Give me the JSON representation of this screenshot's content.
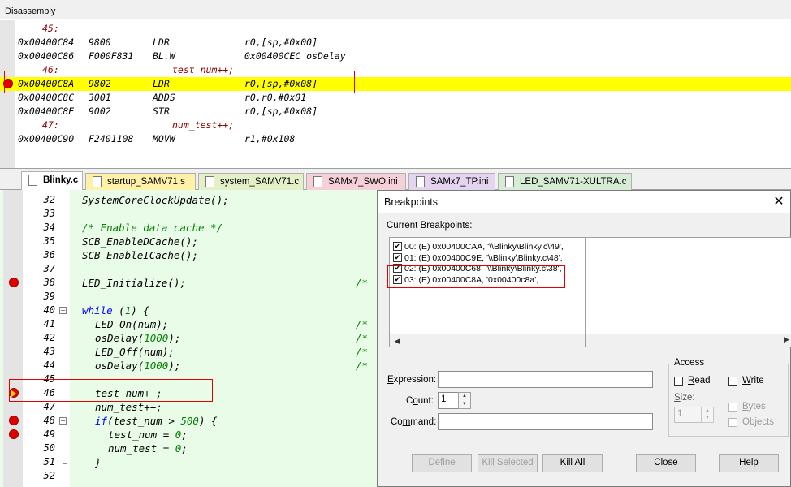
{
  "disassembly": {
    "title": "Disassembly",
    "lines": [
      {
        "kind": "src",
        "num": "45:",
        "text": ""
      },
      {
        "kind": "asm",
        "addr": "0x00400C84",
        "op": "9800",
        "mn": "LDR",
        "args": "r0,[sp,#0x00]"
      },
      {
        "kind": "asm",
        "addr": "0x00400C86",
        "op": "F000F831",
        "mn": "BL.W",
        "args": "0x00400CEC osDelay"
      },
      {
        "kind": "src",
        "num": "46:",
        "text": "test_num++;"
      },
      {
        "kind": "asm",
        "addr": "0x00400C8A",
        "op": "9802",
        "mn": "LDR",
        "args": "r0,[sp,#0x08]",
        "highlight": true,
        "breakpoint": true
      },
      {
        "kind": "asm",
        "addr": "0x00400C8C",
        "op": "3001",
        "mn": "ADDS",
        "args": "r0,r0,#0x01"
      },
      {
        "kind": "asm",
        "addr": "0x00400C8E",
        "op": "9002",
        "mn": "STR",
        "args": "r0,[sp,#0x08]"
      },
      {
        "kind": "src",
        "num": "47:",
        "text": "num_test++;"
      },
      {
        "kind": "asm",
        "addr": "0x00400C90",
        "op": "F2401108",
        "mn": "MOVW",
        "args": "r1,#0x108"
      }
    ]
  },
  "tabs": [
    {
      "label": "Blinky.c",
      "active": true,
      "color": "#ffffff",
      "icon": "c-file-icon"
    },
    {
      "label": "startup_SAMV71.s",
      "color": "#fff2a8",
      "icon": "asm-file-icon"
    },
    {
      "label": "system_SAMV71.c",
      "color": "#e4f0c8",
      "icon": "c-file-icon"
    },
    {
      "label": "SAMx7_SWO.ini",
      "color": "#f6d0d8",
      "icon": "ini-file-icon"
    },
    {
      "label": "SAMx7_TP.ini",
      "color": "#e4d4f0",
      "icon": "ini-file-icon"
    },
    {
      "label": "LED_SAMV71-XULTRA.c",
      "color": "#d6ecd4",
      "icon": "c-file-icon"
    }
  ],
  "editor": {
    "lines": [
      {
        "num": "32",
        "code": "SystemCoreClockUpdate();",
        "indent": 0
      },
      {
        "num": "33",
        "code": "",
        "indent": 0
      },
      {
        "num": "34",
        "code": "/* Enable data cache */",
        "indent": 0,
        "comment": true
      },
      {
        "num": "35",
        "code": "SCB_EnableDCache();",
        "indent": 0
      },
      {
        "num": "36",
        "code": "SCB_EnableICache();",
        "indent": 0
      },
      {
        "num": "37",
        "code": "",
        "indent": 0
      },
      {
        "num": "38",
        "code": "LED_Initialize();",
        "indent": 0,
        "breakpoint": true,
        "tail": "/* "
      },
      {
        "num": "39",
        "code": "",
        "indent": 0
      },
      {
        "num": "40",
        "code": "while (1) {",
        "indent": 0,
        "keyword": "while",
        "fold": true
      },
      {
        "num": "41",
        "code": "LED_On(num);",
        "indent": 1,
        "tail": "/* "
      },
      {
        "num": "42",
        "code": "osDelay(1000);",
        "indent": 1,
        "tail": "/*"
      },
      {
        "num": "43",
        "code": "LED_Off(num);",
        "indent": 1,
        "tail": "/* "
      },
      {
        "num": "44",
        "code": "osDelay(1000);",
        "indent": 1,
        "tail": "/*"
      },
      {
        "num": "45",
        "code": "",
        "indent": 0
      },
      {
        "num": "46",
        "code": "test_num++;",
        "indent": 1,
        "current": true
      },
      {
        "num": "47",
        "code": "num_test++;",
        "indent": 1
      },
      {
        "num": "48",
        "code": "if(test_num > 500) {",
        "indent": 1,
        "keyword": "if",
        "breakpoint": true,
        "fold": true
      },
      {
        "num": "49",
        "code": "test_num = 0;",
        "indent": 2,
        "breakpoint": true
      },
      {
        "num": "50",
        "code": "num_test = 0;",
        "indent": 2
      },
      {
        "num": "51",
        "code": "}",
        "indent": 1
      },
      {
        "num": "52",
        "code": "",
        "indent": 0
      }
    ]
  },
  "dialog": {
    "title": "Breakpoints",
    "close": "✕",
    "current_label": "Current Breakpoints:",
    "breakpoints": [
      {
        "text": "00: (E) 0x00400CAA,  '\\\\Blinky\\Blinky.c\\49',",
        "checked": true
      },
      {
        "text": "01: (E) 0x00400C9E,  '\\\\Blinky\\Blinky.c\\48',",
        "checked": true
      },
      {
        "text": "02: (E) 0x00400C68,  '\\\\Blinky\\Blinky.c\\38',",
        "checked": true
      },
      {
        "text": "03: (E) 0x00400C8A,  '0x00400c8a',",
        "checked": true
      }
    ],
    "expression_label": "Expression:",
    "expression_value": "",
    "count_label": "Count:",
    "count_value": "1",
    "command_label": "Command:",
    "command_value": "",
    "access": {
      "title": "Access",
      "read": "Read",
      "write": "Write",
      "size_label": "Size:",
      "size_value": "1",
      "bytes": "Bytes",
      "objects": "Objects"
    },
    "buttons": {
      "define": "Define",
      "kill_selected": "Kill Selected",
      "kill_all": "Kill All",
      "close": "Close",
      "help": "Help"
    }
  }
}
